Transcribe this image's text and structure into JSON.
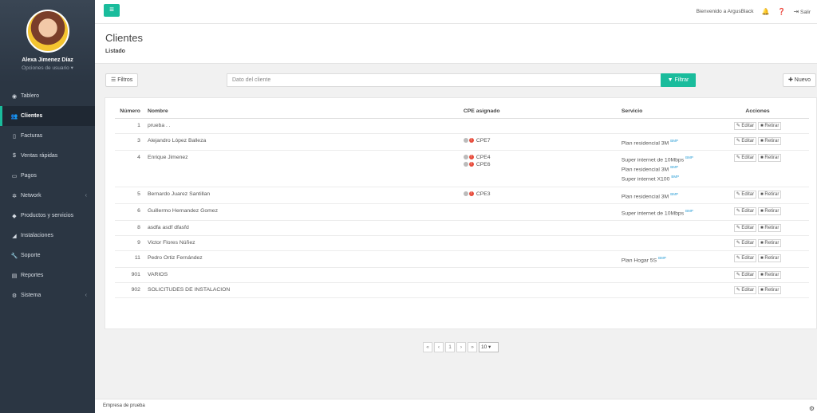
{
  "sidebar": {
    "user_name": "Alexa Jimenez Díaz",
    "user_options": "Opciones de usuario ▾",
    "items": [
      {
        "label": "Tablero",
        "icon": "dashboard-icon",
        "glyph": "◉"
      },
      {
        "label": "Clientes",
        "icon": "users-icon",
        "glyph": "👥",
        "active": true
      },
      {
        "label": "Facturas",
        "icon": "file-icon",
        "glyph": "▯"
      },
      {
        "label": "Ventas rápidas",
        "icon": "dollar-icon",
        "glyph": "$"
      },
      {
        "label": "Pagos",
        "icon": "money-icon",
        "glyph": "▭"
      },
      {
        "label": "Network",
        "icon": "network-icon",
        "glyph": "✲",
        "chevron": true
      },
      {
        "label": "Productos y servicios",
        "icon": "tag-icon",
        "glyph": "◆"
      },
      {
        "label": "Instalaciones",
        "icon": "tool-icon",
        "glyph": "◢"
      },
      {
        "label": "Soporte",
        "icon": "wrench-icon",
        "glyph": "🔧"
      },
      {
        "label": "Reportes",
        "icon": "book-icon",
        "glyph": "▤"
      },
      {
        "label": "Sistema",
        "icon": "cogs-icon",
        "glyph": "⚙",
        "chevron": true
      }
    ]
  },
  "topbar": {
    "menu_toggle": "≡",
    "welcome": "Bienvenido a ArgusBlack",
    "logout": "Salir"
  },
  "header": {
    "title": "Clientes",
    "subtitle": "Listado"
  },
  "filters": {
    "filtros_label": "☰ Filtros",
    "search_placeholder": "Dato del cliente",
    "filtrar_label": "▼ Filtrar",
    "nuevo_label": "✚ Nuevo"
  },
  "table": {
    "headers": [
      "Número",
      "Nombre",
      "CPE asignado",
      "Servicio",
      "Acciones"
    ],
    "edit_label": "✎ Editar",
    "remove_label": "■ Retirar",
    "badge": "BMP",
    "rows": [
      {
        "num": "1",
        "name": "prueba . .",
        "cpes": [],
        "services": []
      },
      {
        "num": "3",
        "name": "Alejandro López Balleza",
        "cpes": [
          "CPE7"
        ],
        "services": [
          "Plan residencial 3M"
        ]
      },
      {
        "num": "4",
        "name": "Enrique Jimenez",
        "cpes": [
          "CPE4",
          "CPE6"
        ],
        "services": [
          "Super internet de 10Mbps",
          "Plan residencial 3M",
          "Super internet X100"
        ]
      },
      {
        "num": "5",
        "name": "Bernardo Juarez Santillan",
        "cpes": [
          "CPE3"
        ],
        "services": [
          "Plan residencial 3M"
        ]
      },
      {
        "num": "6",
        "name": "Guillermo Hernandez Gomez",
        "cpes": [],
        "services": [
          "Super internet de 10Mbps"
        ]
      },
      {
        "num": "8",
        "name": "asdfa asdf dfasfd",
        "cpes": [],
        "services": []
      },
      {
        "num": "9",
        "name": "Victor Flores Núñez",
        "cpes": [],
        "services": []
      },
      {
        "num": "11",
        "name": "Pedro Ortiz Fernández",
        "cpes": [],
        "services": [
          "Plan Hogar 5S"
        ]
      },
      {
        "num": "901",
        "name": "VARIOS",
        "cpes": [],
        "services": []
      },
      {
        "num": "902",
        "name": "SOLICITUDES DE INSTALACION",
        "cpes": [],
        "services": []
      }
    ]
  },
  "pagination": {
    "first": "«",
    "prev": "‹",
    "page": "1",
    "next": "›",
    "last": "»",
    "per_page": "10 ▾"
  },
  "footer": {
    "text": "Empresa de prueba"
  },
  "colors": {
    "accent": "#1abc9c",
    "sidebar": "#2b3643"
  }
}
